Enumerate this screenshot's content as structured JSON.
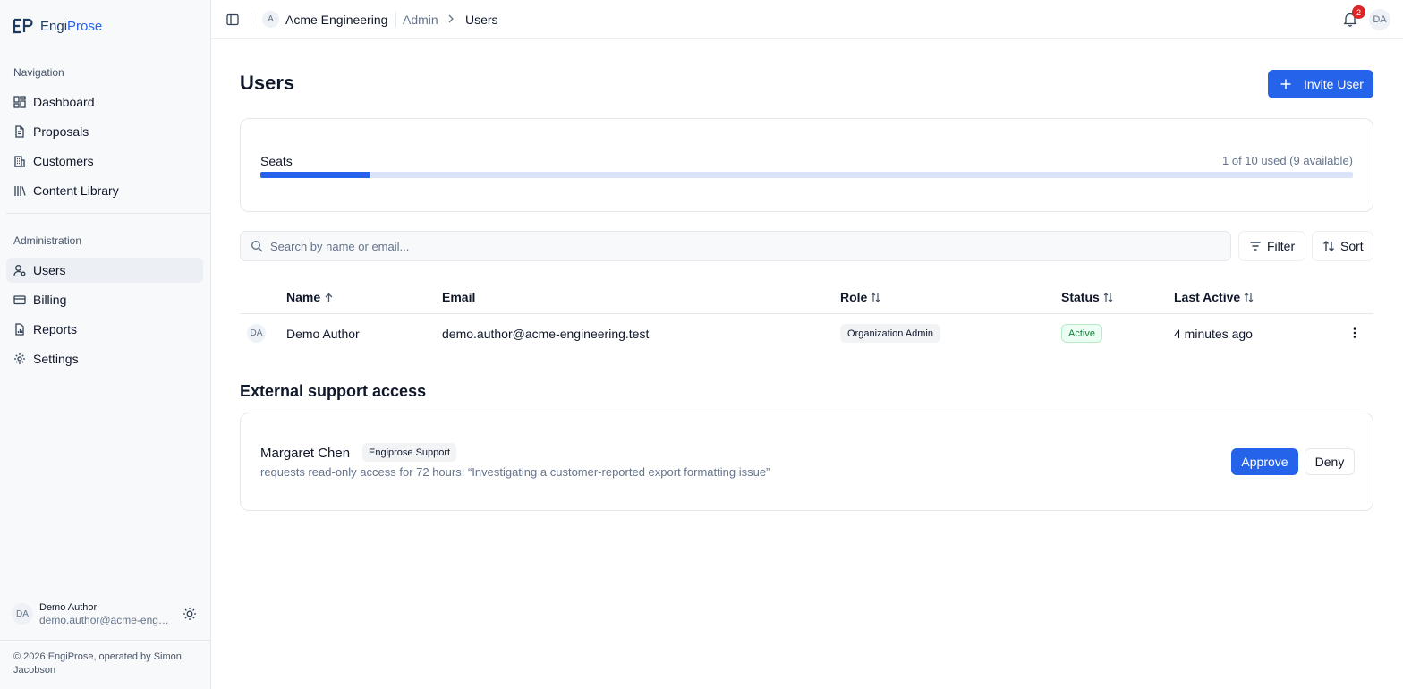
{
  "brand": {
    "name_part1": "Engi",
    "name_part2": "Prose"
  },
  "sidebar": {
    "nav_heading": "Navigation",
    "nav_items": [
      {
        "label": "Dashboard",
        "icon": "dashboard-icon"
      },
      {
        "label": "Proposals",
        "icon": "document-icon"
      },
      {
        "label": "Customers",
        "icon": "building-icon"
      },
      {
        "label": "Content Library",
        "icon": "library-icon"
      }
    ],
    "admin_heading": "Administration",
    "admin_items": [
      {
        "label": "Users",
        "icon": "user-gear-icon",
        "active": true
      },
      {
        "label": "Billing",
        "icon": "credit-card-icon"
      },
      {
        "label": "Reports",
        "icon": "report-icon"
      },
      {
        "label": "Settings",
        "icon": "gear-icon"
      }
    ],
    "user": {
      "initials": "DA",
      "name": "Demo Author",
      "email": "demo.author@acme-engineering.test"
    },
    "footer": "© 2026 EngiProse, operated by Simon Jacobson"
  },
  "topbar": {
    "org_initial": "A",
    "org_name": "Acme Engineering",
    "breadcrumb_admin": "Admin",
    "breadcrumb_current": "Users",
    "notification_count": "2",
    "user_initials": "DA"
  },
  "page": {
    "title": "Users",
    "invite_label": "Invite User"
  },
  "seats": {
    "label": "Seats",
    "usage_text": "1 of 10 used (9 available)",
    "used": 1,
    "total": 10
  },
  "search": {
    "placeholder": "Search by name or email...",
    "value": ""
  },
  "toolbar": {
    "filter_label": "Filter",
    "sort_label": "Sort"
  },
  "table": {
    "columns": [
      {
        "label": "Name",
        "sort": "asc"
      },
      {
        "label": "Email",
        "sort": "none"
      },
      {
        "label": "Role",
        "sort": "sortable"
      },
      {
        "label": "Status",
        "sort": "sortable"
      },
      {
        "label": "Last Active",
        "sort": "sortable"
      }
    ],
    "rows": [
      {
        "initials": "DA",
        "name": "Demo Author",
        "email": "demo.author@acme-engineering.test",
        "role": "Organization Admin",
        "status": "Active",
        "last_active": "4 minutes ago"
      }
    ]
  },
  "support": {
    "section_title": "External support access",
    "requester": "Margaret Chen",
    "badge": "Engiprose Support",
    "description": "requests read-only access for 72 hours: “Investigating a customer-reported export formatting issue”",
    "approve_label": "Approve",
    "deny_label": "Deny"
  },
  "colors": {
    "accent": "#2563eb",
    "active_nav_bg": "#eceff3",
    "status_active": "#15803d",
    "notification": "#dc2626"
  }
}
